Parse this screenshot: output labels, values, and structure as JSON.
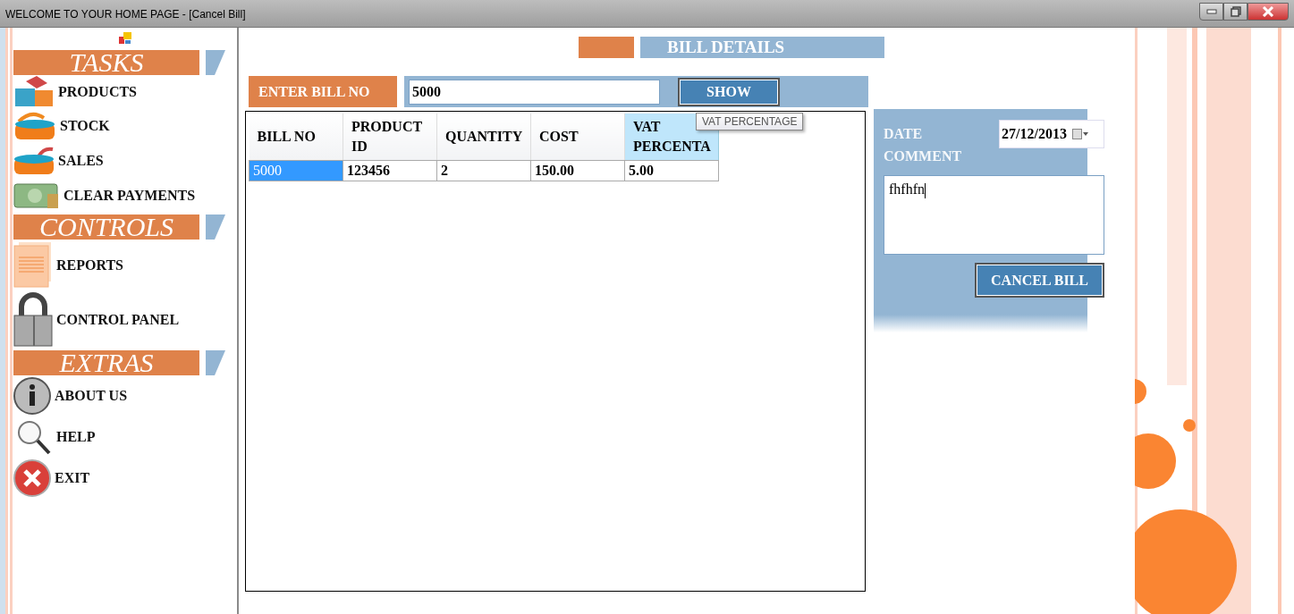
{
  "window": {
    "title": "WELCOME TO YOUR HOME PAGE - [Cancel Bill]"
  },
  "sidebar": {
    "sections": [
      {
        "heading": "TASKS",
        "items": [
          {
            "label": "PRODUCTS"
          },
          {
            "label": "STOCK"
          },
          {
            "label": "SALES"
          },
          {
            "label": "CLEAR PAYMENTS"
          }
        ]
      },
      {
        "heading": "CONTROLS",
        "items": [
          {
            "label": "REPORTS"
          },
          {
            "label": "CONTROL PANEL"
          }
        ]
      },
      {
        "heading": "EXTRAS",
        "items": [
          {
            "label": "ABOUT US"
          },
          {
            "label": "HELP"
          },
          {
            "label": "EXIT"
          }
        ]
      }
    ]
  },
  "bill_details": {
    "title": "BILL DETAILS",
    "bill_no_label": "ENTER BILL NO",
    "bill_no_value": "5000",
    "show_button": "SHOW"
  },
  "table": {
    "columns": [
      {
        "label": "BILL NO",
        "highlighted": false
      },
      {
        "label": "PRODUCT ID",
        "highlighted": false
      },
      {
        "label": "QUANTITY",
        "highlighted": false
      },
      {
        "label": "COST",
        "highlighted": false
      },
      {
        "label": "VAT PERCENTA",
        "highlighted": true
      }
    ],
    "rows": [
      {
        "cells": [
          {
            "text": "5000",
            "selected": true
          },
          {
            "text": "123456",
            "selected": false
          },
          {
            "text": "2",
            "selected": false
          },
          {
            "text": "150.00",
            "selected": false
          },
          {
            "text": "5.00",
            "selected": false
          }
        ]
      }
    ]
  },
  "tooltip": "VAT PERCENTAGE",
  "cancel_form": {
    "date_label": "DATE",
    "date_value": "27/12/2013",
    "comment_label": "COMMENT",
    "comment_value": "fhfhfn",
    "cancel_button": "CANCEL BILL"
  }
}
